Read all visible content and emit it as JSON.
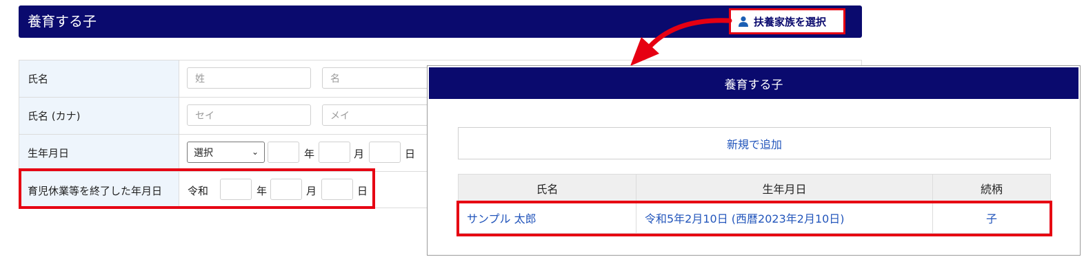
{
  "header": {
    "title": "養育する子",
    "select_family_button": "扶養家族を選択"
  },
  "form": {
    "rows": [
      {
        "label": "氏名",
        "placeholders": [
          "姓",
          "名"
        ]
      },
      {
        "label": "氏名 (カナ)",
        "placeholders": [
          "セイ",
          "メイ"
        ]
      },
      {
        "label": "生年月日",
        "era_select": "選択",
        "units": [
          "年",
          "月",
          "日"
        ]
      },
      {
        "label": "育児休業等を終了した年月日",
        "era": "令和",
        "units": [
          "年",
          "月",
          "日"
        ]
      }
    ]
  },
  "modal": {
    "title": "養育する子",
    "add_new": "新規で追加",
    "columns": [
      "氏名",
      "生年月日",
      "続柄"
    ],
    "rows": [
      {
        "name": "サンプル 太郎",
        "birthdate": "令和5年2月10日 (西暦2023年2月10日)",
        "relation": "子"
      }
    ]
  },
  "colors": {
    "header_bg": "#0a0a6e",
    "highlight": "#e60012",
    "link": "#2255bb",
    "label_bg": "#eef5fc"
  }
}
